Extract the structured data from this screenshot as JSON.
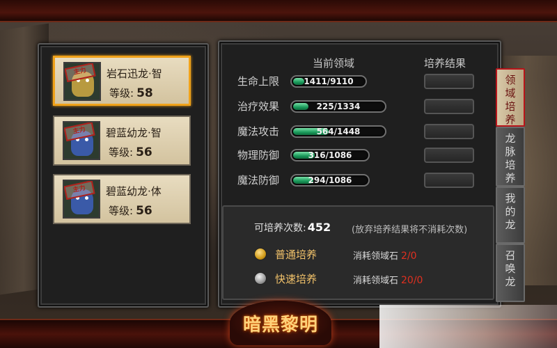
{
  "dragons": [
    {
      "name": "岩石迅龙·智",
      "level_label": "等级:",
      "level": "58",
      "stamp": "主力",
      "selected": true,
      "color": "#b89a40"
    },
    {
      "name": "碧蓝幼龙·智",
      "level_label": "等级:",
      "level": "56",
      "stamp": "主力",
      "selected": false,
      "color": "#3a5aa8"
    },
    {
      "name": "碧蓝幼龙·体",
      "level_label": "等级:",
      "level": "56",
      "stamp": "主力",
      "selected": false,
      "color": "#3a5aa8"
    }
  ],
  "stats_panel": {
    "current_header": "当前领域",
    "result_header": "培养结果",
    "stats": [
      {
        "label": "生命上限",
        "current": 1411,
        "max": 9110,
        "value_text": "1411/9110"
      },
      {
        "label": "治疗效果",
        "current": 225,
        "max": 1334,
        "value_text": "225/1334"
      },
      {
        "label": "魔法攻击",
        "current": 564,
        "max": 1448,
        "value_text": "564/1448"
      },
      {
        "label": "物理防御",
        "current": 316,
        "max": 1086,
        "value_text": "316/1086"
      },
      {
        "label": "魔法防御",
        "current": 294,
        "max": 1086,
        "value_text": "294/1086"
      }
    ]
  },
  "training": {
    "count_label": "可培养次数:",
    "count_value": "452",
    "note": "(放弃培养结果将不消耗次数)",
    "options": [
      {
        "label": "普通培养",
        "cost_label": "消耗领域石",
        "cost_value": "2/0",
        "orb": "gold"
      },
      {
        "label": "快速培养",
        "cost_label": "消耗领域石",
        "cost_value": "20/0",
        "orb": "silver"
      }
    ]
  },
  "side_tabs": [
    {
      "label": "领域培养",
      "active": true
    },
    {
      "label": "龙脉培养",
      "active": false
    },
    {
      "label": "我的龙",
      "active": false
    },
    {
      "label": "召唤龙",
      "active": false
    }
  ],
  "logo_text": "暗黑黎明",
  "colors": {
    "selected_border": "#f0a21a",
    "bar_fill": "#1a9a5b",
    "cost_red": "#e03020",
    "option_gold": "#f2c26a"
  }
}
